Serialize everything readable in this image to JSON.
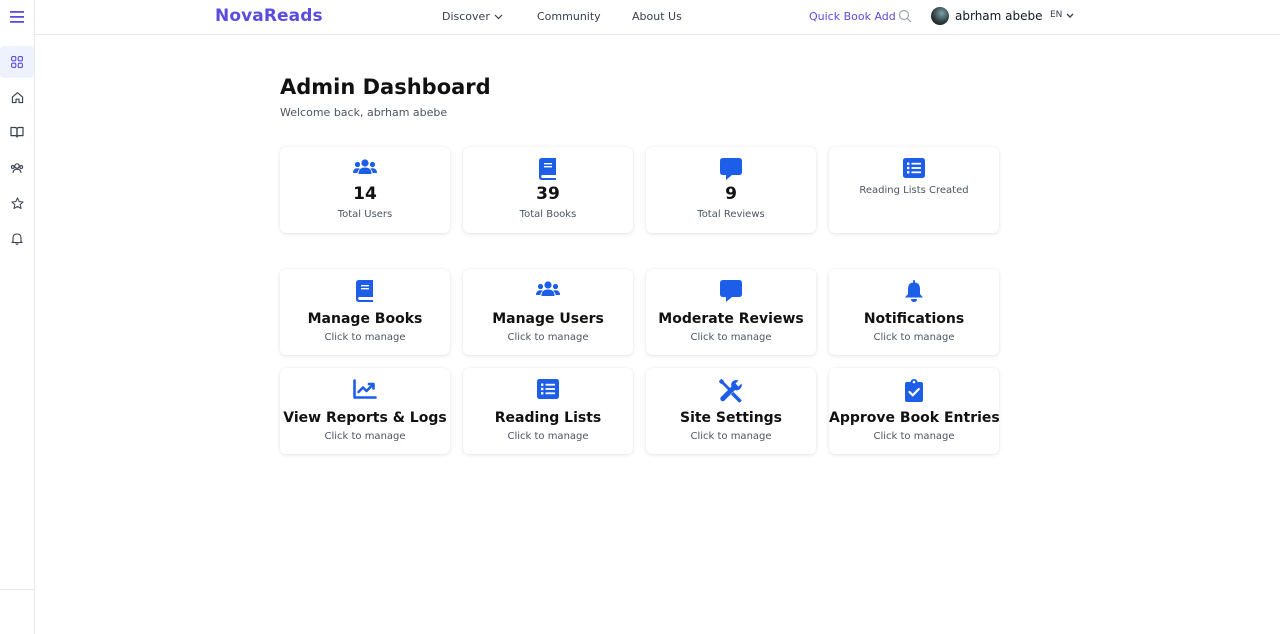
{
  "header": {
    "brand": "NovaReads",
    "nav": [
      {
        "label": "Discover",
        "has_dropdown": true
      },
      {
        "label": "Community"
      },
      {
        "label": "About Us"
      }
    ],
    "quick_add": "Quick Book Add",
    "username": "abrham abebe",
    "language": "EN"
  },
  "sidebar": {
    "items": [
      {
        "name": "dashboard",
        "icon": "grid-icon",
        "active": true
      },
      {
        "name": "home",
        "icon": "home-icon"
      },
      {
        "name": "books",
        "icon": "book-open-icon"
      },
      {
        "name": "community",
        "icon": "users-icon"
      },
      {
        "name": "favorites",
        "icon": "star-icon"
      },
      {
        "name": "notifications",
        "icon": "bell-icon"
      }
    ]
  },
  "main": {
    "title": "Admin Dashboard",
    "welcome": "Welcome back, abrham abebe",
    "stats": [
      {
        "icon": "users-icon",
        "value": "14",
        "label": "Total Users"
      },
      {
        "icon": "book-icon",
        "value": "39",
        "label": "Total Books"
      },
      {
        "icon": "comment-icon",
        "value": "9",
        "label": "Total Reviews"
      },
      {
        "icon": "list-icon",
        "value": "",
        "label": "Reading Lists Created"
      }
    ],
    "actions": [
      {
        "icon": "book-icon",
        "title": "Manage Books",
        "subtitle": "Click to manage"
      },
      {
        "icon": "users-icon",
        "title": "Manage Users",
        "subtitle": "Click to manage"
      },
      {
        "icon": "comment-icon",
        "title": "Moderate Reviews",
        "subtitle": "Click to manage"
      },
      {
        "icon": "bell-icon",
        "title": "Notifications",
        "subtitle": "Click to manage"
      },
      {
        "icon": "chart-line-icon",
        "title": "View Reports & Logs",
        "subtitle": "Click to manage"
      },
      {
        "icon": "list-icon",
        "title": "Reading Lists",
        "subtitle": "Click to manage"
      },
      {
        "icon": "tools-icon",
        "title": "Site Settings",
        "subtitle": "Click to manage"
      },
      {
        "icon": "clipboard-check-icon",
        "title": "Approve Book Entries",
        "subtitle": "Click to manage"
      }
    ]
  },
  "colors": {
    "brand": "#5b4ce0",
    "icon_blue": "#1d5ee8",
    "text": "#111827",
    "muted": "#4b5563"
  }
}
